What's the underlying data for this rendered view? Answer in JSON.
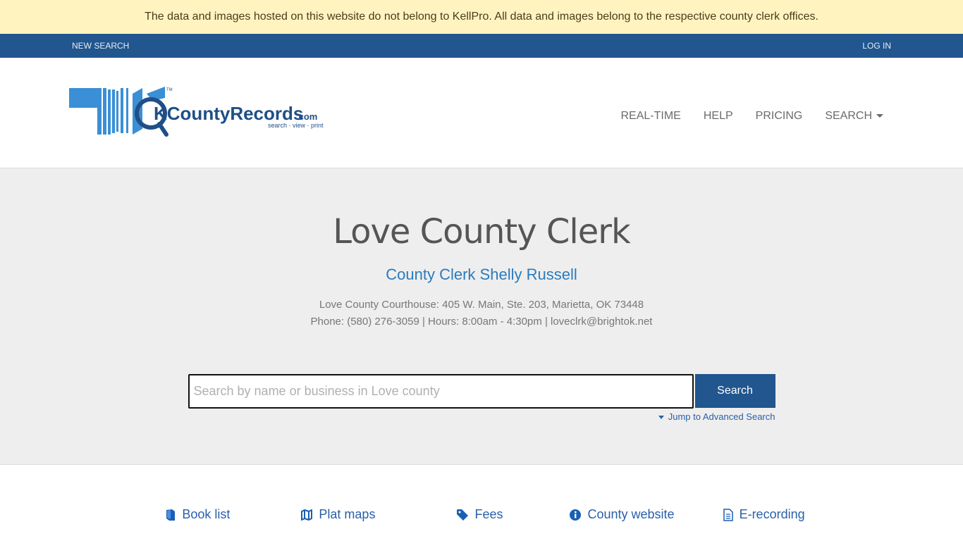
{
  "notice": "The data and images hosted on this website do not belong to KellPro. All data and images belong to the respective county clerk offices.",
  "topbar": {
    "new_search": "NEW SEARCH",
    "login": "LOG IN"
  },
  "logo": {
    "brand": "OKCountyRecords",
    "tld": ".com",
    "tagline": "search • view • print",
    "tm": "™"
  },
  "nav": [
    {
      "label": "REAL-TIME"
    },
    {
      "label": "HELP"
    },
    {
      "label": "PRICING"
    },
    {
      "label": "SEARCH"
    }
  ],
  "hero": {
    "title": "Love County Clerk",
    "subtitle": "County Clerk Shelly Russell",
    "address": "Love County Courthouse: 405 W. Main, Ste. 203, Marietta, OK 73448",
    "contact": "Phone: (580) 276-3059 | Hours: 8:00am - 4:30pm | loveclrk@brightok.net"
  },
  "search": {
    "placeholder": "Search by name or business in Love county",
    "value": "",
    "button": "Search",
    "advanced": "Jump to Advanced Search"
  },
  "links": [
    {
      "label": "Book list",
      "icon": "book-icon"
    },
    {
      "label": "Plat maps",
      "icon": "map-icon"
    },
    {
      "label": "Fees",
      "icon": "tag-icon"
    },
    {
      "label": "County website",
      "icon": "info-icon"
    },
    {
      "label": "E-recording",
      "icon": "document-icon"
    }
  ],
  "colors": {
    "brand_blue": "#21568f",
    "link_blue": "#2a5fa8",
    "notice_bg": "#fff4c0",
    "hero_bg": "#eeeeee"
  }
}
